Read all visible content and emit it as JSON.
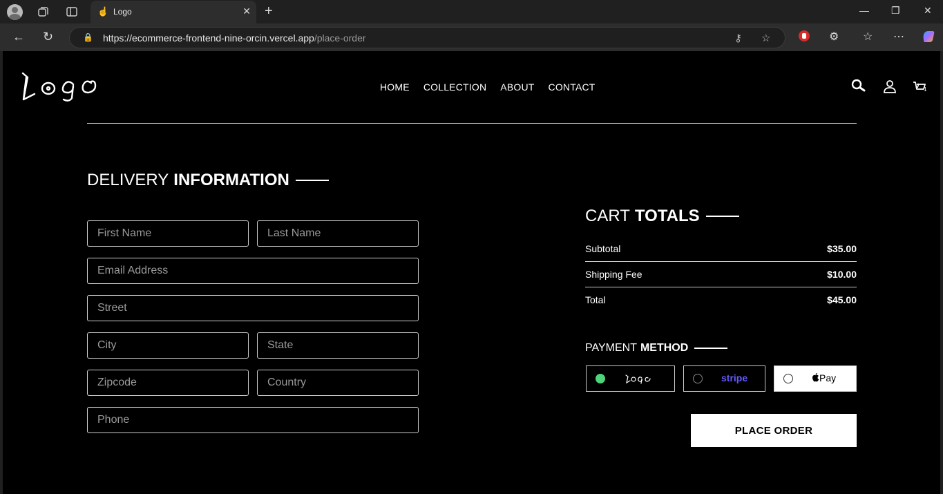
{
  "browser": {
    "tab_title": "Logo",
    "url_host": "https://ecommerce-frontend-nine-orcin.vercel.app",
    "url_path": "/place-order"
  },
  "header": {
    "nav": [
      "HOME",
      "COLLECTION",
      "ABOUT",
      "CONTACT"
    ],
    "cart_count": "1"
  },
  "delivery": {
    "title_light": "DELIVERY",
    "title_bold": "INFORMATION",
    "placeholders": {
      "first_name": "First Name",
      "last_name": "Last Name",
      "email": "Email Address",
      "street": "Street",
      "city": "City",
      "state": "State",
      "zipcode": "Zipcode",
      "country": "Country",
      "phone": "Phone"
    }
  },
  "cart": {
    "title_light": "CART",
    "title_bold": "TOTALS",
    "rows": [
      {
        "label": "Subtotal",
        "value": "$35.00"
      },
      {
        "label": "Shipping Fee",
        "value": "$10.00"
      },
      {
        "label": "Total",
        "value": "$45.00"
      }
    ]
  },
  "payment": {
    "title_light": "PAYMENT",
    "title_bold": "METHOD",
    "stripe_label": "stripe",
    "applepay_label": "Pay",
    "selected": "logo"
  },
  "colors": {
    "selected_radio": "#4fd47c",
    "stripe": "#635bff"
  },
  "place_order_label": "PLACE ORDER"
}
